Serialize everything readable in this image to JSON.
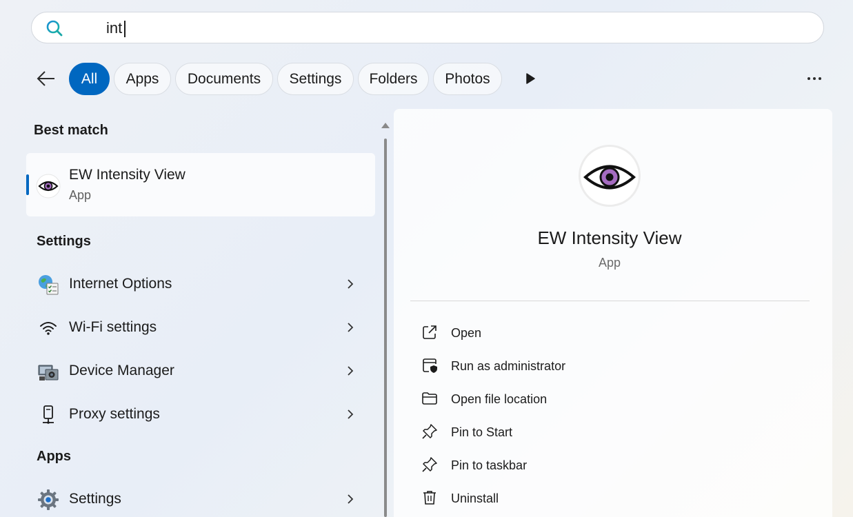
{
  "search": {
    "query": "int",
    "icon": "search-icon"
  },
  "filters": {
    "back_icon": "back-arrow-icon",
    "chips": [
      "All",
      "Apps",
      "Documents",
      "Settings",
      "Folders",
      "Photos"
    ],
    "active": "All",
    "play_icon": "play-icon",
    "more_icon": "more-icon"
  },
  "best_match": {
    "heading": "Best match",
    "name": "EW Intensity View",
    "type": "App",
    "icon": "eye-icon"
  },
  "settings": {
    "heading": "Settings",
    "items": [
      {
        "label": "Internet Options",
        "icon": "internet-options-icon"
      },
      {
        "label": "Wi-Fi settings",
        "icon": "wifi-icon"
      },
      {
        "label": "Device Manager",
        "icon": "device-manager-icon"
      },
      {
        "label": "Proxy settings",
        "icon": "proxy-icon"
      }
    ]
  },
  "apps": {
    "heading": "Apps",
    "items": [
      {
        "label": "Settings",
        "icon": "gear-icon"
      }
    ]
  },
  "detail": {
    "name": "EW Intensity View",
    "type": "App",
    "actions": [
      {
        "label": "Open",
        "icon": "open-external-icon"
      },
      {
        "label": "Run as administrator",
        "icon": "shield-window-icon"
      },
      {
        "label": "Open file location",
        "icon": "folder-icon"
      },
      {
        "label": "Pin to Start",
        "icon": "pin-icon"
      },
      {
        "label": "Pin to taskbar",
        "icon": "pin-icon"
      },
      {
        "label": "Uninstall",
        "icon": "trash-icon"
      }
    ]
  },
  "colors": {
    "accent": "#0067c0",
    "eye_iris": "#a56cc1"
  }
}
